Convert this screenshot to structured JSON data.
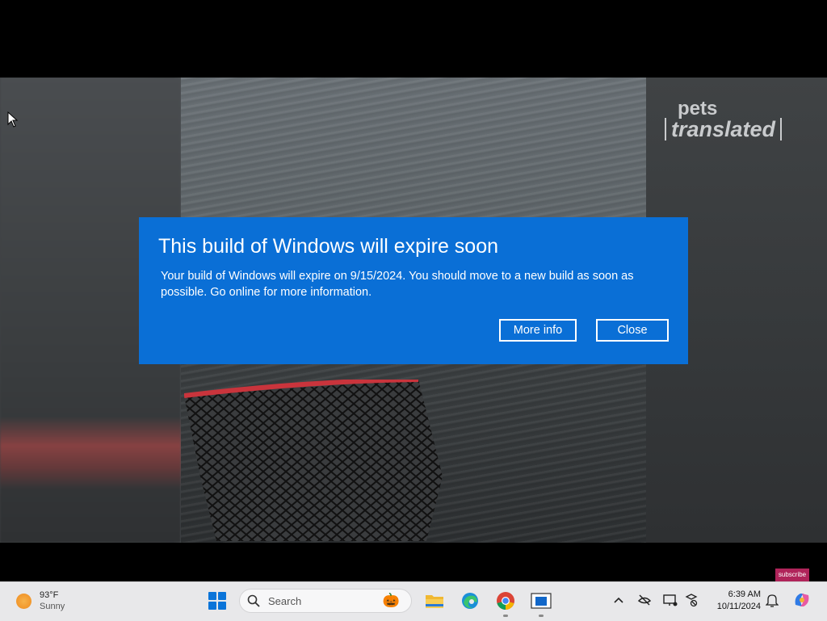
{
  "video": {
    "watermark_top": "pets",
    "watermark_bottom": "translated",
    "subscribe_label": "subscribe"
  },
  "dialog": {
    "title": "This build of Windows will expire soon",
    "message": "Your build of Windows will expire on 9/15/2024. You should move to a new build as soon as possible. Go online for more information.",
    "more_info_label": "More info",
    "close_label": "Close",
    "background_color": "#0a6fd6"
  },
  "taskbar": {
    "weather": {
      "temperature": "93°F",
      "condition": "Sunny",
      "icon": "sun-icon"
    },
    "search_placeholder": "Search",
    "apps": [
      {
        "name": "windows-start-icon"
      },
      {
        "name": "file-explorer-icon"
      },
      {
        "name": "edge-browser-icon"
      },
      {
        "name": "chrome-browser-icon"
      },
      {
        "name": "app-window-icon"
      }
    ],
    "tray": [
      "chevron-up-icon",
      "network-offline-icon",
      "display-icon",
      "location-icon"
    ],
    "clock": {
      "time": "6:39 AM",
      "date": "10/11/2024"
    }
  }
}
